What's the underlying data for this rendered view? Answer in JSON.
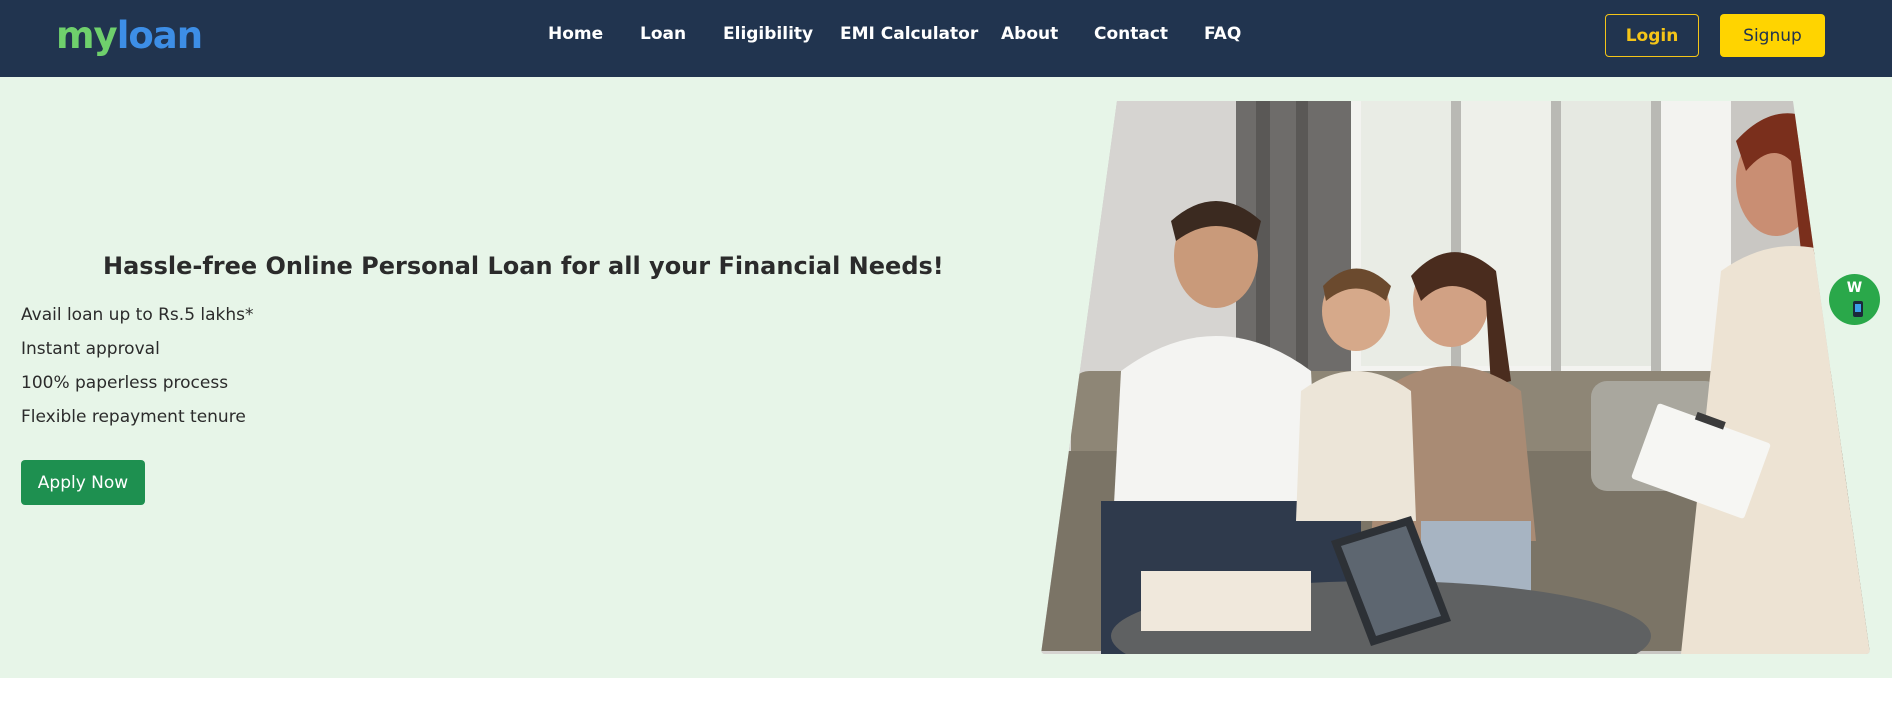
{
  "brand": {
    "part1": "my",
    "part2": "loan"
  },
  "nav": {
    "items": [
      {
        "label": "Home"
      },
      {
        "label": "Loan"
      },
      {
        "label": "Eligibility"
      },
      {
        "label": "EMI Calculator"
      },
      {
        "label": "About"
      },
      {
        "label": "Contact"
      },
      {
        "label": "FAQ"
      }
    ]
  },
  "auth": {
    "login_label": "Login",
    "signup_label": "Signup"
  },
  "hero": {
    "title": "Hassle-free Online Personal Loan for all your Financial Needs!",
    "features": [
      "Avail loan up to Rs.5 lakhs*",
      "Instant approval",
      "100% paperless process",
      "Flexible repayment tenure"
    ],
    "apply_label": "Apply Now"
  },
  "floating": {
    "whatsapp_label": "W"
  },
  "colors": {
    "navbar": "#21344f",
    "hero_bg": "#e7f5e8",
    "accent_yellow": "#ffd400",
    "apply_green": "#1e9050",
    "logo_green": "#6fd06c",
    "logo_blue": "#3d8ee6"
  }
}
